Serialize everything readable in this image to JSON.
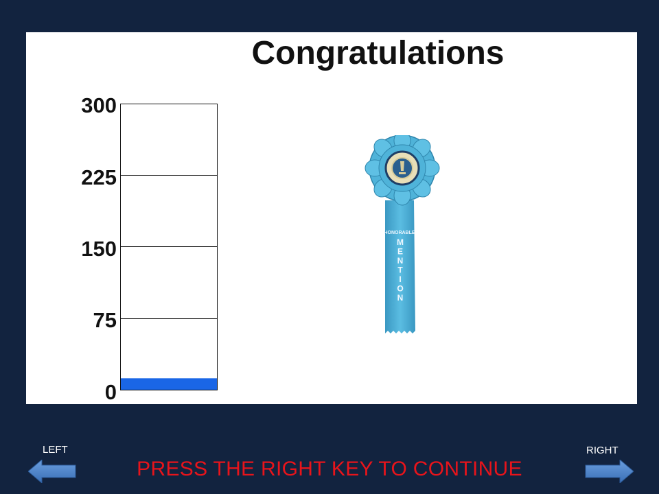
{
  "slide": {
    "title": "Congratulations",
    "prompt": "PRESS THE RIGHT KEY TO CONTINUE"
  },
  "nav": {
    "left_label": "LEFT",
    "right_label": "RIGHT"
  },
  "meter": {
    "ticks": [
      "300",
      "225",
      "150",
      "75",
      "0"
    ],
    "max": 300,
    "value": 12,
    "fill_color": "#1a66e6"
  },
  "award": {
    "icon": "ribbon-icon",
    "line1": "HONORABLE",
    "line2": "MENTION",
    "color": "#4fb3d9"
  }
}
